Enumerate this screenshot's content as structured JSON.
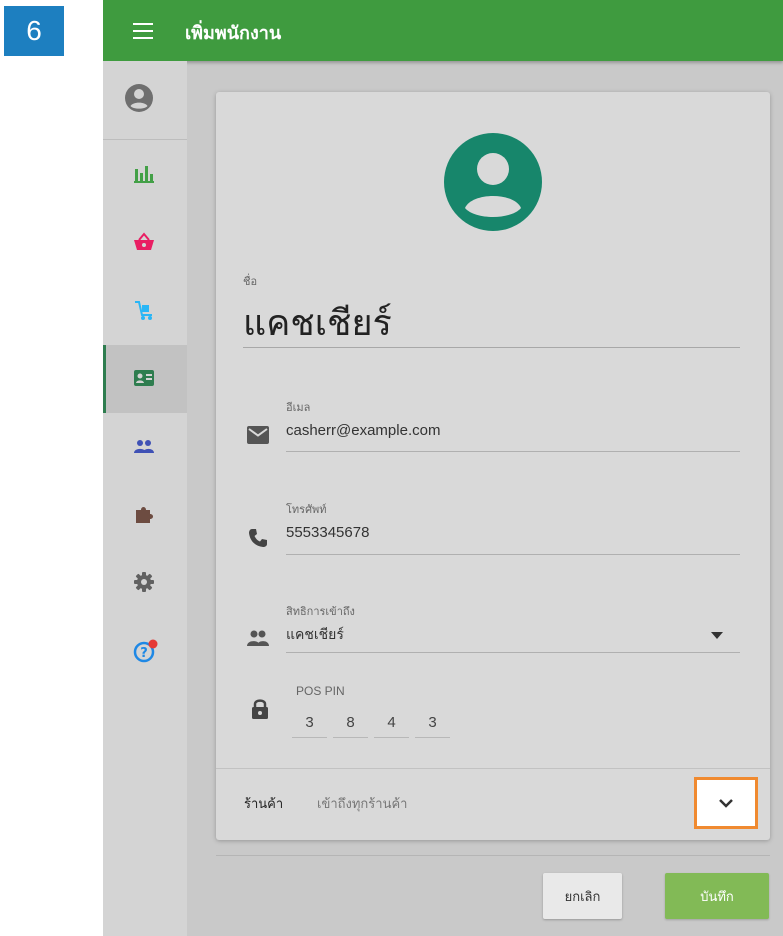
{
  "step_badge": "6",
  "header": {
    "title": "เพิ่มพนักงาน"
  },
  "sidebar": {
    "items": [
      {
        "icon": "account-circle-icon"
      },
      {
        "icon": "bar-chart-icon",
        "color": "#43a047"
      },
      {
        "icon": "shopping-basket-icon",
        "color": "#e91e63"
      },
      {
        "icon": "inventory-cart-icon",
        "color": "#29b6f6"
      },
      {
        "icon": "employee-badge-icon",
        "color": "#2e7d4f",
        "active": true
      },
      {
        "icon": "customers-icon",
        "color": "#3f51b5"
      },
      {
        "icon": "puzzle-icon",
        "color": "#6d4c41"
      },
      {
        "icon": "gear-icon",
        "color": "#616161"
      },
      {
        "icon": "help-icon",
        "color": "#1e88e5",
        "badge_color": "#e53935"
      }
    ]
  },
  "form": {
    "avatar_color": "#17866b",
    "name": {
      "label": "ชื่อ",
      "value": "แคชเชียร์"
    },
    "email": {
      "label": "อีเมล",
      "value": "casherr@example.com"
    },
    "phone": {
      "label": "โทรศัพท์",
      "value": "5553345678"
    },
    "role": {
      "label": "สิทธิการเข้าถึง",
      "value": "แคชเชียร์"
    },
    "pin": {
      "label": "POS PIN",
      "digits": [
        "3",
        "8",
        "4",
        "3"
      ]
    },
    "store": {
      "label": "ร้านค้า",
      "value": "เข้าถึงทุกร้านค้า"
    }
  },
  "buttons": {
    "cancel": "ยกเลิก",
    "save": "บันทึก"
  },
  "colors": {
    "topbar": "#3f9b3f",
    "save": "#82ba56",
    "highlight": "#f08a30",
    "badge": "#1d7fc0"
  }
}
